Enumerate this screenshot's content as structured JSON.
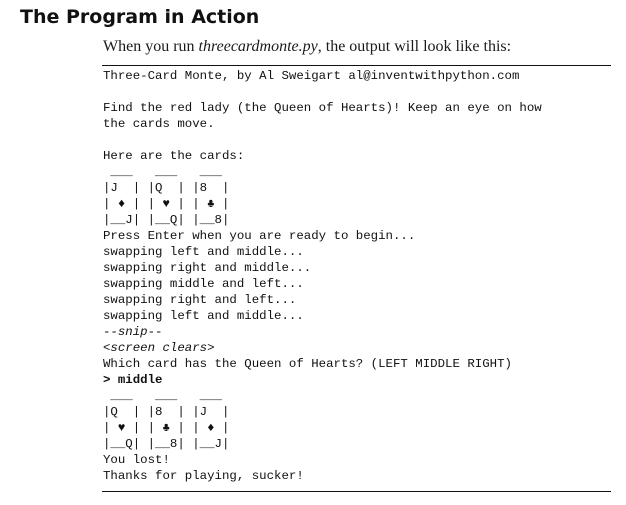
{
  "section": {
    "heading": "The Program in Action"
  },
  "intro": {
    "before": "When you run ",
    "filename": "threecardmonte.py",
    "after": ", the output will look like this:"
  },
  "terminal": {
    "lines": [
      "Three-Card Monte, by Al Sweigart al@inventwithpython.com",
      "",
      "Find the red lady (the Queen of Hearts)! Keep an eye on how",
      "the cards move.",
      "",
      "Here are the cards:",
      " ___   ___   ___",
      "|J  | |Q  | |8  |",
      "| ♦ | | ♥ | | ♣ |",
      "|__J| |__Q| |__8|",
      "Press Enter when you are ready to begin...",
      "swapping left and middle...",
      "swapping right and middle...",
      "swapping middle and left...",
      "swapping right and left...",
      "swapping left and middle...",
      "--snip--",
      "<screen clears>",
      "Which card has the Queen of Hearts? (LEFT MIDDLE RIGHT)",
      "> middle",
      " ___   ___   ___",
      "|Q  | |8  | |J  |",
      "| ♥ | | ♣ | | ♦ |",
      "|__Q| |__8| |__J|",
      "You lost!",
      "Thanks for playing, sucker!"
    ]
  }
}
